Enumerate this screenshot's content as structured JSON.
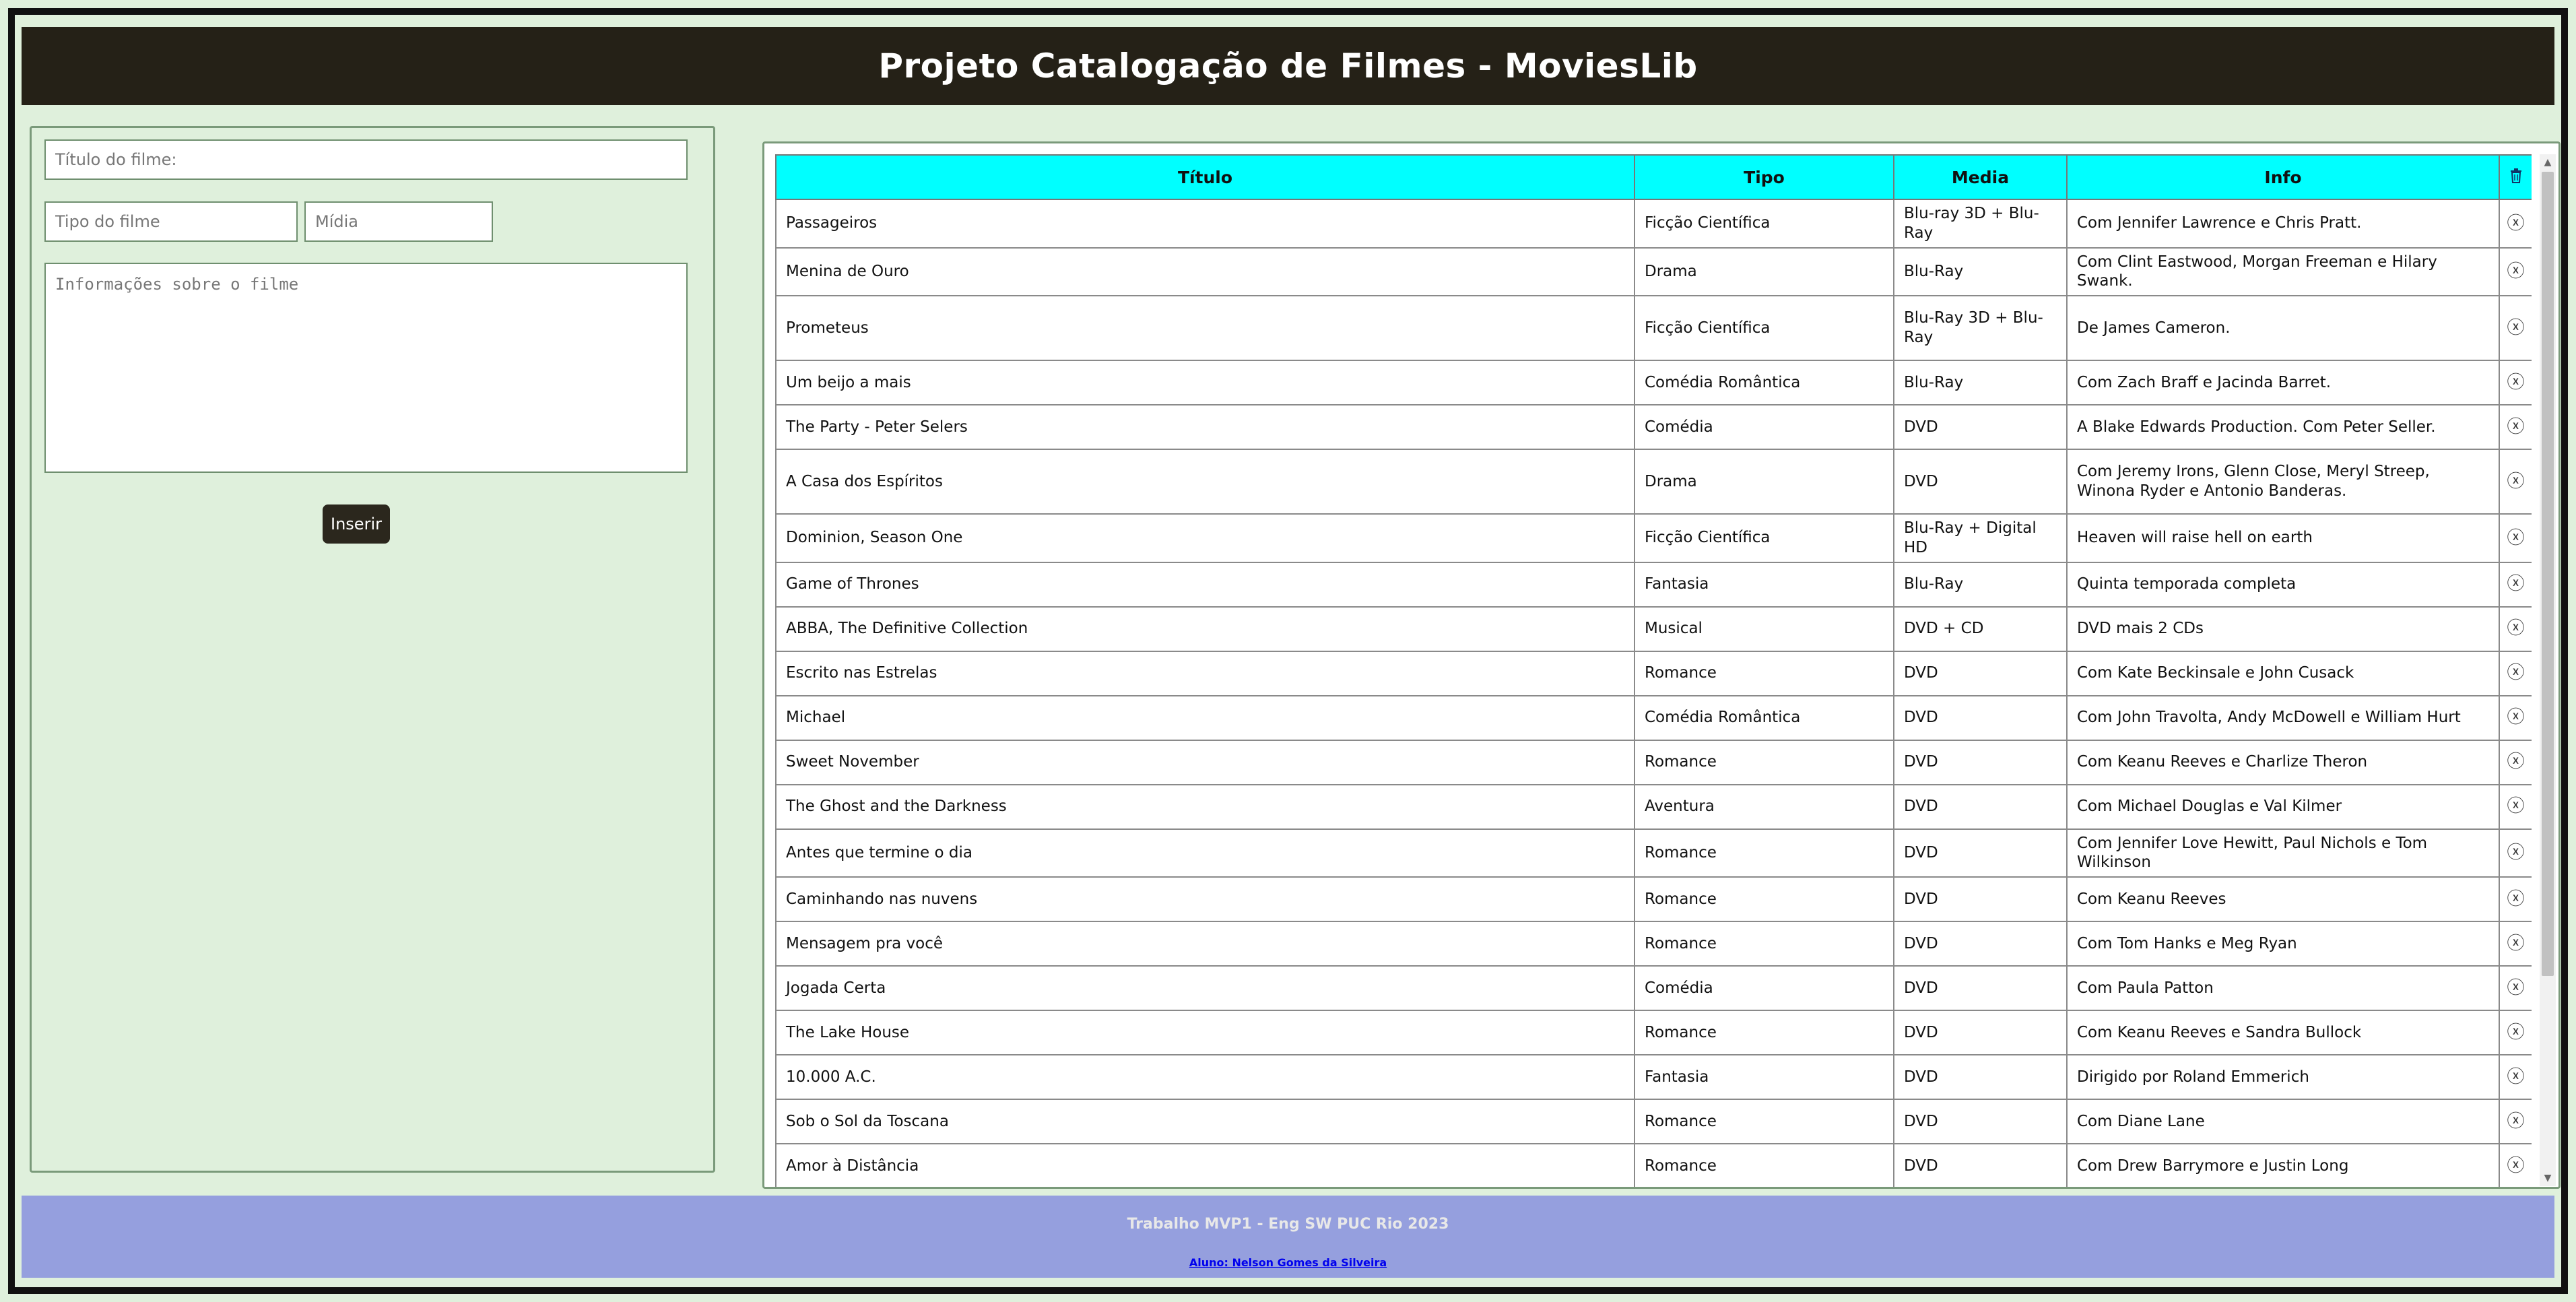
{
  "header": {
    "title": "Projeto Catalogação de Filmes - MoviesLib"
  },
  "form": {
    "title_placeholder": "Título do filme:",
    "type_placeholder": "Tipo do filme",
    "media_placeholder": "Mídia",
    "info_placeholder": "Informações sobre o filme",
    "insert_label": "Inserir"
  },
  "table": {
    "headers": {
      "titulo": "Título",
      "tipo": "Tipo",
      "media": "Media",
      "info": "Info",
      "delete_icon": "trash-icon"
    },
    "rows": [
      {
        "titulo": "Passageiros",
        "tipo": "Ficção Científica",
        "media": "Blu-ray 3D + Blu-Ray",
        "info": "Com Jennifer Lawrence e Chris Pratt."
      },
      {
        "titulo": "Menina de Ouro",
        "tipo": "Drama",
        "media": "Blu-Ray",
        "info": "Com Clint Eastwood, Morgan Freeman e Hilary Swank."
      },
      {
        "titulo": "Prometeus",
        "tipo": "Ficção Científica",
        "media": "Blu-Ray 3D + Blu-Ray",
        "info": "De James Cameron."
      },
      {
        "titulo": "Um beijo a mais",
        "tipo": "Comédia Romântica",
        "media": "Blu-Ray",
        "info": "Com Zach Braff e Jacinda Barret."
      },
      {
        "titulo": "The Party - Peter Selers",
        "tipo": "Comédia",
        "media": "DVD",
        "info": "A Blake Edwards Production. Com Peter Seller."
      },
      {
        "titulo": "A Casa dos Espíritos",
        "tipo": "Drama",
        "media": "DVD",
        "info": "Com Jeremy Irons, Glenn Close, Meryl Streep, Winona Ryder e Antonio Banderas."
      },
      {
        "titulo": "Dominion, Season One",
        "tipo": "Ficção Científica",
        "media": "Blu-Ray + Digital HD",
        "info": "Heaven will raise hell on earth"
      },
      {
        "titulo": "Game of Thrones",
        "tipo": "Fantasia",
        "media": "Blu-Ray",
        "info": "Quinta temporada completa"
      },
      {
        "titulo": "ABBA, The Definitive Collection",
        "tipo": "Musical",
        "media": "DVD + CD",
        "info": "DVD mais 2 CDs"
      },
      {
        "titulo": "Escrito nas Estrelas",
        "tipo": "Romance",
        "media": "DVD",
        "info": "Com Kate Beckinsale e John Cusack"
      },
      {
        "titulo": "Michael",
        "tipo": "Comédia Romântica",
        "media": "DVD",
        "info": "Com John Travolta, Andy McDowell e William Hurt"
      },
      {
        "titulo": "Sweet November",
        "tipo": "Romance",
        "media": "DVD",
        "info": "Com Keanu Reeves e Charlize Theron"
      },
      {
        "titulo": "The Ghost and the Darkness",
        "tipo": "Aventura",
        "media": "DVD",
        "info": "Com Michael Douglas e Val Kilmer"
      },
      {
        "titulo": "Antes que termine o dia",
        "tipo": "Romance",
        "media": "DVD",
        "info": "Com Jennifer Love Hewitt, Paul Nichols e Tom Wilkinson"
      },
      {
        "titulo": "Caminhando nas nuvens",
        "tipo": "Romance",
        "media": "DVD",
        "info": "Com Keanu Reeves"
      },
      {
        "titulo": "Mensagem pra você",
        "tipo": "Romance",
        "media": "DVD",
        "info": "Com Tom Hanks e Meg Ryan"
      },
      {
        "titulo": "Jogada Certa",
        "tipo": "Comédia",
        "media": "DVD",
        "info": "Com Paula Patton"
      },
      {
        "titulo": "The Lake House",
        "tipo": "Romance",
        "media": "DVD",
        "info": "Com Keanu Reeves e Sandra Bullock"
      },
      {
        "titulo": "10.000 A.C.",
        "tipo": "Fantasia",
        "media": "DVD",
        "info": "Dirigido por Roland Emmerich"
      },
      {
        "titulo": "Sob o Sol da Toscana",
        "tipo": "Romance",
        "media": "DVD",
        "info": "Com Diane Lane"
      },
      {
        "titulo": "Amor à Distância",
        "tipo": "Romance",
        "media": "DVD",
        "info": "Com Drew Barrymore e Justin Long"
      }
    ],
    "delete_glyph": "ⓧ"
  },
  "footer": {
    "line1": "Trabalho MVP1 - Eng SW PUC Rio 2023",
    "line2": "Aluno: Nelson Gomes da Silveira"
  }
}
